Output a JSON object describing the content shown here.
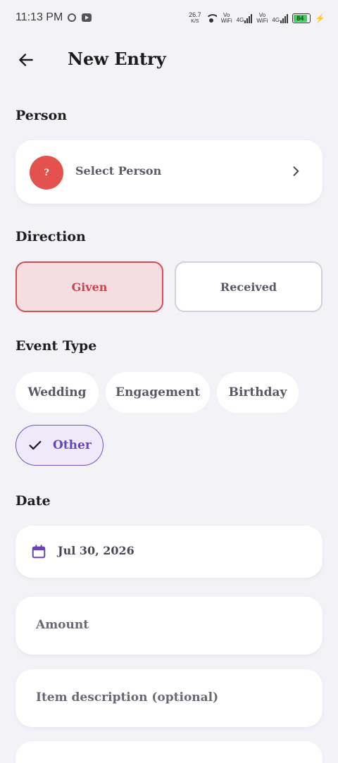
{
  "status_bar": {
    "time": "11:13 PM",
    "net_speed_value": "26.7",
    "net_speed_unit": "K/S",
    "vo_wifi_1_top": "Vo",
    "vo_wifi_1_bottom": "WiFi",
    "net_4g_1": "4G",
    "vo_wifi_2_top": "Vo",
    "vo_wifi_2_bottom": "WiFi",
    "net_4g_2": "4G",
    "battery_level": "84",
    "battery_color": "#3fd15b"
  },
  "app_bar": {
    "back_icon": "arrow-left-icon",
    "title": "New Entry"
  },
  "person": {
    "section_label": "Person",
    "avatar_text": "?",
    "avatar_color": "#e3524f",
    "select_text": "Select Person",
    "chevron_icon": "chevron-right-icon"
  },
  "direction": {
    "section_label": "Direction",
    "options": [
      "Given",
      "Received"
    ],
    "selected": "Given",
    "selected_color": "#d34e55"
  },
  "event_type": {
    "section_label": "Event Type",
    "options": [
      "Wedding",
      "Engagement",
      "Birthday",
      "Other"
    ],
    "selected": "Other",
    "selected_color": "#7454b8",
    "check_icon": "check-icon"
  },
  "date": {
    "section_label": "Date",
    "calendar_icon": "calendar-icon",
    "value": "Jul 30, 2026",
    "icon_color": "#6a45b4"
  },
  "form": {
    "amount_placeholder": "Amount",
    "description_placeholder": "Item description (optional)"
  }
}
